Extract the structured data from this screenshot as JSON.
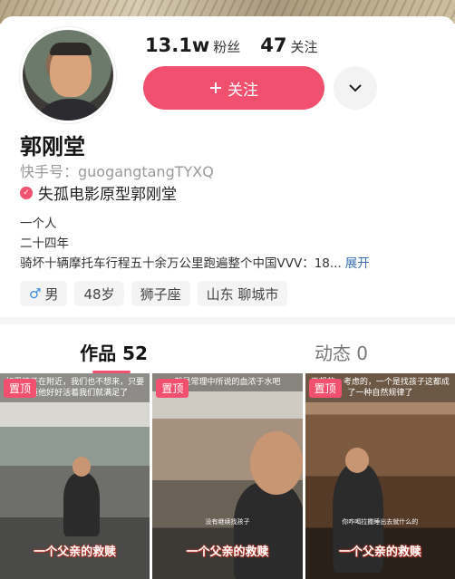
{
  "profile": {
    "followers_count": "13.1w",
    "followers_label": "粉丝",
    "following_count": "47",
    "following_label": "关注",
    "follow_button_label": "关注",
    "follow_button_icon": "plus-icon",
    "name": "郭刚堂",
    "kuaishou_id": "快手号：guogangtangTYXQ",
    "verified_text": "失孤电影原型郭刚堂",
    "bio_lines": [
      "一个人",
      "二十四年",
      "骑坏十辆摩托车行程五十余万公里跑遍整个中国VVV：18..."
    ],
    "expand_label": "展开",
    "tags": {
      "gender": "男",
      "age": "48岁",
      "zodiac": "狮子座",
      "location": "山东 聊城市"
    }
  },
  "tabs": [
    {
      "label": "作品 52",
      "active": true
    },
    {
      "label": "动态 0",
      "active": false
    }
  ],
  "works": [
    {
      "pinned_label": "置顶",
      "top_caption": "如果孩子在附近，我们也不想来，只要知道他好好活着我们就满足了",
      "caption": "一个父亲的救赎"
    },
    {
      "pinned_label": "置顶",
      "top_caption": "就是常理中所说的血浓于水吧",
      "subtitle": "没有继续找孩子",
      "caption": "一个父亲的救赎"
    },
    {
      "pinned_label": "置顶",
      "top_caption": "天想的，考虑的，一个是找孩子这都成了一种自然规律了",
      "subtitle": "你咋喝拉撒睡出去就什么的",
      "caption": "一个父亲的救赎"
    }
  ],
  "colors": {
    "accent": "#f2506f",
    "link": "#3b6fb6"
  }
}
